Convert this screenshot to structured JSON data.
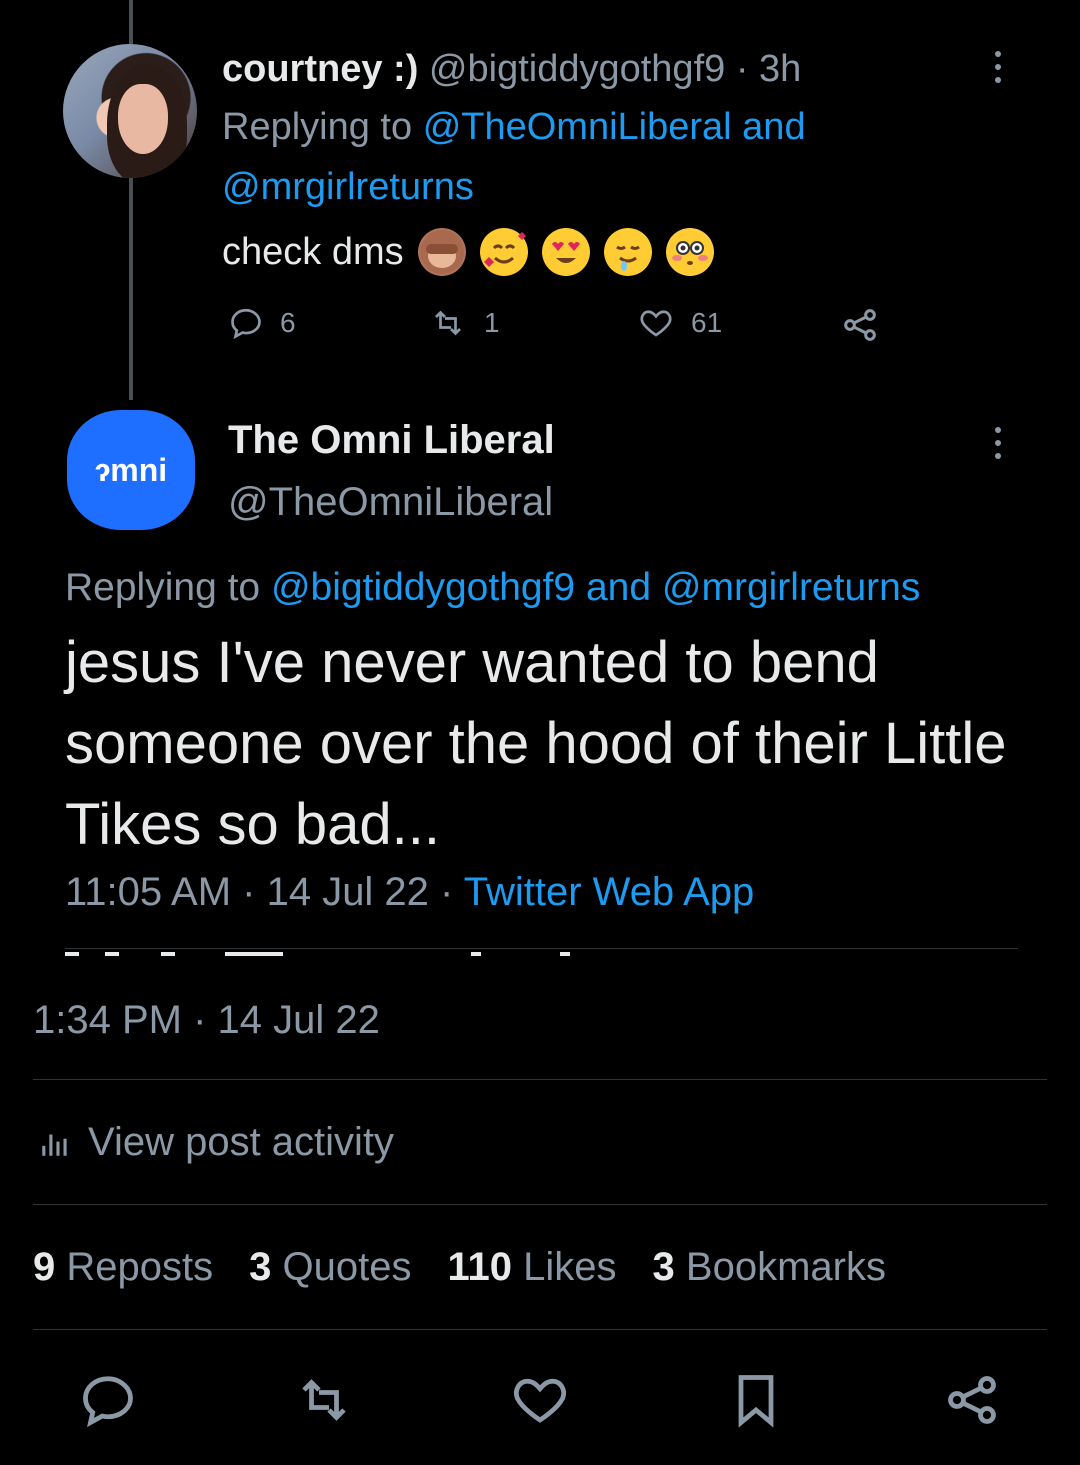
{
  "tweet1": {
    "display_name": "courtney :)",
    "handle": "@bigtiddygothgf9",
    "time": "· 3h",
    "replying_prefix": "Replying to",
    "reply_target1": "@TheOmniLiberal",
    "reply_joiner": "and",
    "reply_target2": "@mrgirlreturns",
    "text": "check dms",
    "emojis": [
      "see-no-evil-monkey",
      "smiling-face-with-hearts",
      "heart-eyes",
      "drooling-face",
      "flushed-face"
    ],
    "replies": "6",
    "reposts": "1",
    "likes": "61"
  },
  "tweet2": {
    "avatar_text": "ɂmni",
    "display_name": "The Omni Liberal",
    "handle": "@TheOmniLiberal",
    "replying_prefix": "Replying to",
    "reply_target1": "@bigtiddygothgf9",
    "reply_joiner": "and",
    "reply_target2": "@mrgirlreturns",
    "text": "jesus I've never wanted to bend someone over the hood of their Little Tikes so bad...",
    "time": "11:05 AM · 14 Jul 22 ·",
    "source": "Twitter Web App"
  },
  "post": {
    "timestamp": "1:34 PM · 14 Jul 22",
    "activity_label": "View post activity",
    "stats": [
      {
        "num": "9",
        "label": "Reposts"
      },
      {
        "num": "3",
        "label": "Quotes"
      },
      {
        "num": "110",
        "label": "Likes"
      },
      {
        "num": "3",
        "label": "Bookmarks"
      }
    ]
  },
  "colors": {
    "background": "#000000",
    "text": "#e7e9ea",
    "muted": "#8b98a5",
    "link": "#1d9bf0",
    "omni_blue": "#1e6eff",
    "divider": "#2f3336"
  }
}
